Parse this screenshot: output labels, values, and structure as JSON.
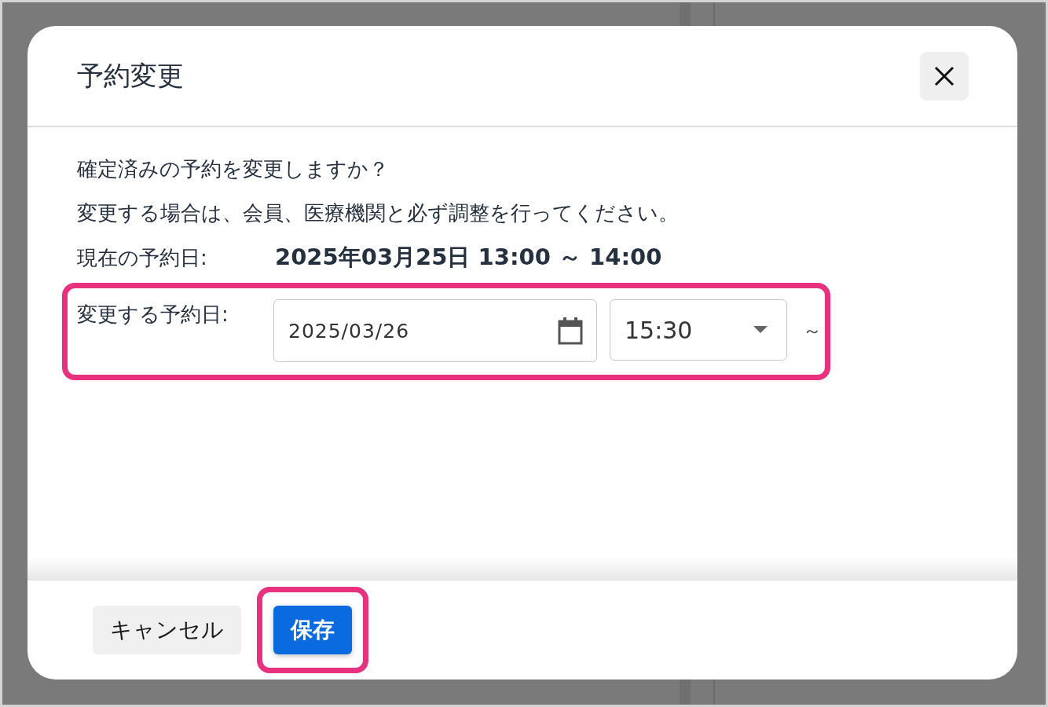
{
  "dialog": {
    "title": "予約変更"
  },
  "messages": [
    "確定済みの予約を変更しますか？",
    "変更する場合は、会員、医療機関と必ず調整を行ってください。"
  ],
  "current": {
    "label": "現在の予約日:",
    "value": "2025年03月25日 13:00 ～ 14:00"
  },
  "change": {
    "label": "変更する予約日:",
    "date": "2025/03/26",
    "time": "15:30",
    "separator": "～",
    "highlighted": true
  },
  "buttons": [
    {
      "label": "キャンセル",
      "kind": "secondary",
      "highlighted": false
    },
    {
      "label": "保存",
      "kind": "primary",
      "highlighted": true
    }
  ]
}
